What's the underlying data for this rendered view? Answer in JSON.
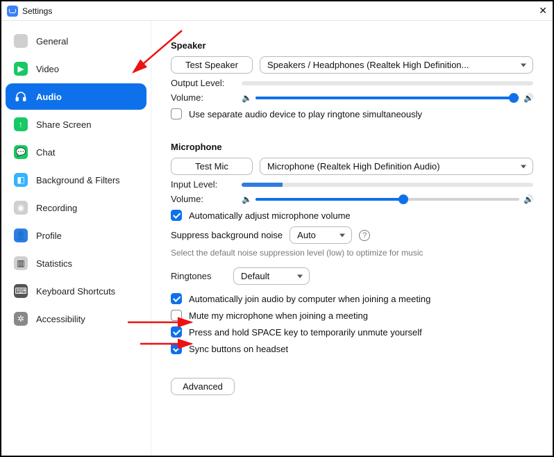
{
  "window": {
    "title": "Settings"
  },
  "sidebar": {
    "items": [
      {
        "label": "General"
      },
      {
        "label": "Video"
      },
      {
        "label": "Audio"
      },
      {
        "label": "Share Screen"
      },
      {
        "label": "Chat"
      },
      {
        "label": "Background & Filters"
      },
      {
        "label": "Recording"
      },
      {
        "label": "Profile"
      },
      {
        "label": "Statistics"
      },
      {
        "label": "Keyboard Shortcuts"
      },
      {
        "label": "Accessibility"
      }
    ],
    "active_index": 2
  },
  "speaker": {
    "heading": "Speaker",
    "test_btn": "Test Speaker",
    "device": "Speakers / Headphones (Realtek High Definition...",
    "output_level_label": "Output Level:",
    "output_level_pct": 0,
    "volume_label": "Volume:",
    "volume_pct": 98,
    "separate_ringtone": "Use separate audio device to play ringtone simultaneously",
    "separate_ringtone_checked": false
  },
  "mic": {
    "heading": "Microphone",
    "test_btn": "Test Mic",
    "device": "Microphone (Realtek High Definition Audio)",
    "input_level_label": "Input Level:",
    "input_level_pct": 14,
    "volume_label": "Volume:",
    "volume_pct": 56,
    "auto_adjust": "Automatically adjust microphone volume",
    "auto_adjust_checked": true,
    "suppress_label": "Suppress background noise",
    "suppress_value": "Auto",
    "help_text": "Select the default noise suppression level (low) to optimize for music"
  },
  "ringtones": {
    "label": "Ringtones",
    "value": "Default"
  },
  "options": {
    "auto_join_audio": {
      "label": "Automatically join audio by computer when joining a meeting",
      "checked": true
    },
    "mute_on_join": {
      "label": "Mute my microphone when joining a meeting",
      "checked": false
    },
    "space_unmute": {
      "label": "Press and hold SPACE key to temporarily unmute yourself",
      "checked": true
    },
    "sync_headset": {
      "label": "Sync buttons on headset",
      "checked": true
    }
  },
  "advanced_btn": "Advanced",
  "colors": {
    "accent": "#0e71eb"
  }
}
